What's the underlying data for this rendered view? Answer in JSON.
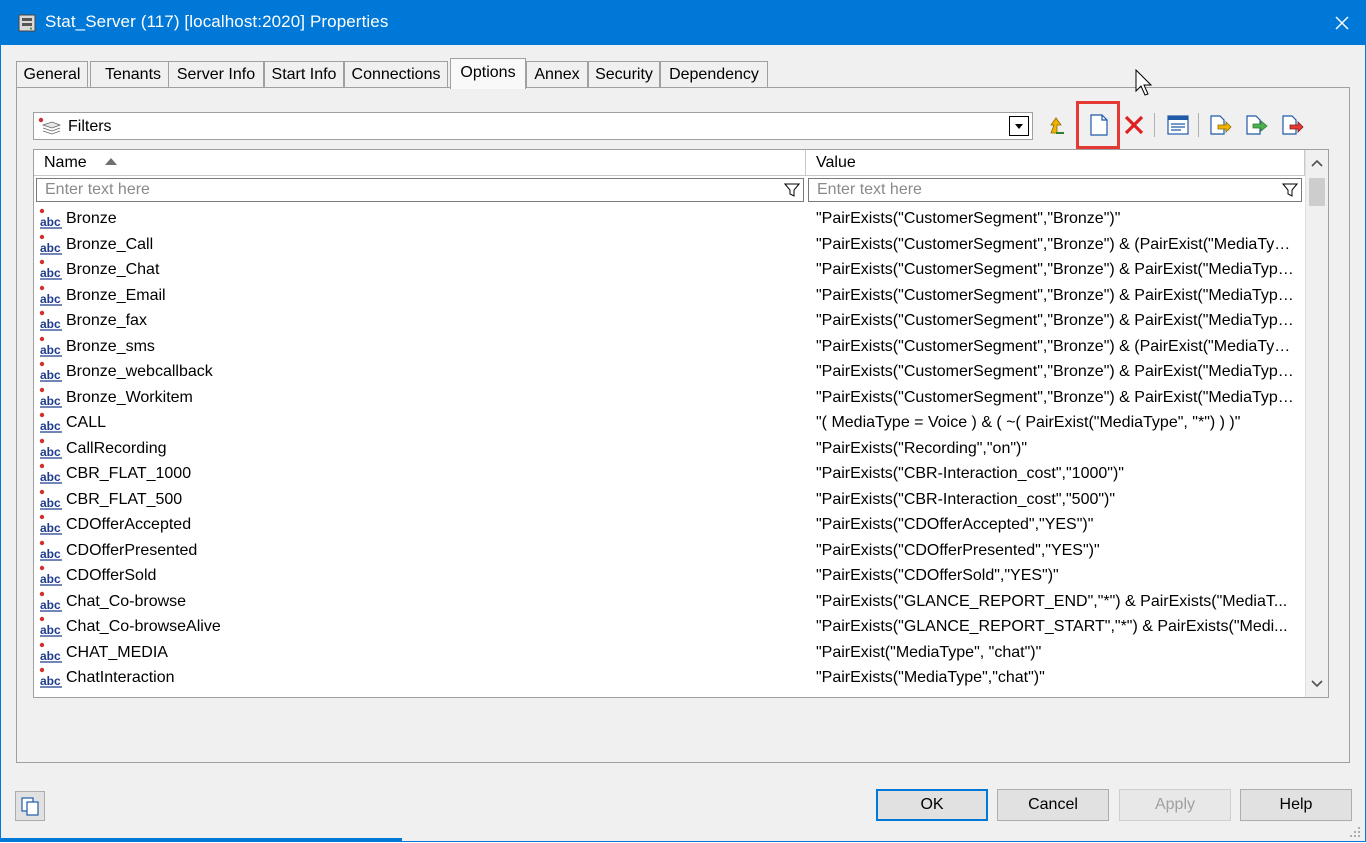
{
  "window": {
    "title": "Stat_Server (117) [localhost:2020] Properties",
    "accent": "#0078d7",
    "app_icon": "server-icon"
  },
  "tabs": [
    {
      "label": "General",
      "active": false
    },
    {
      "label": "Tenants",
      "active": false
    },
    {
      "label": "Server Info",
      "active": false
    },
    {
      "label": "Start Info",
      "active": false
    },
    {
      "label": "Connections",
      "active": false
    },
    {
      "label": "Options",
      "active": true
    },
    {
      "label": "Annex",
      "active": false
    },
    {
      "label": "Security",
      "active": false
    },
    {
      "label": "Dependency",
      "active": false
    }
  ],
  "section_combo": {
    "selected": "Filters",
    "icon": "section-stack-icon"
  },
  "toolbar": {
    "buttons": [
      {
        "name": "up-level-button",
        "icon": "up-arrow-icon"
      },
      {
        "name": "new-option-button",
        "icon": "new-document-icon",
        "highlighted": true
      },
      {
        "name": "delete-button",
        "icon": "red-x-icon"
      },
      {
        "name": "properties-button",
        "icon": "properties-icon"
      },
      {
        "name": "import-button",
        "icon": "import-icon"
      },
      {
        "name": "export-button",
        "icon": "export-icon"
      },
      {
        "name": "copy-section-button",
        "icon": "copy-section-icon"
      }
    ],
    "highlight_color": "#e53935"
  },
  "grid": {
    "columns": [
      {
        "label": "Name",
        "sort": "ascending"
      },
      {
        "label": "Value"
      }
    ],
    "filter_placeholder": "Enter text here",
    "rows": [
      {
        "name": "Bronze",
        "value": "\"PairExists(\"CustomerSegment\",\"Bronze\")\""
      },
      {
        "name": "Bronze_Call",
        "value": "\"PairExists(\"CustomerSegment\",\"Bronze\") & (PairExist(\"MediaTyp..."
      },
      {
        "name": "Bronze_Chat",
        "value": "\"PairExists(\"CustomerSegment\",\"Bronze\") & PairExist(\"MediaType..."
      },
      {
        "name": "Bronze_Email",
        "value": "\"PairExists(\"CustomerSegment\",\"Bronze\") & PairExist(\"MediaType..."
      },
      {
        "name": "Bronze_fax",
        "value": "\"PairExists(\"CustomerSegment\",\"Bronze\") & PairExist(\"MediaType..."
      },
      {
        "name": "Bronze_sms",
        "value": "\"PairExists(\"CustomerSegment\",\"Bronze\") & (PairExist(\"MediaTyp..."
      },
      {
        "name": "Bronze_webcallback",
        "value": "\"PairExists(\"CustomerSegment\",\"Bronze\") & PairExist(\"MediaType..."
      },
      {
        "name": "Bronze_Workitem",
        "value": "\"PairExists(\"CustomerSegment\",\"Bronze\") & PairExist(\"MediaType..."
      },
      {
        "name": "CALL",
        "value": "\"( MediaType = Voice ) & ( ~( PairExist(\"MediaType\", \"*\") ) )\""
      },
      {
        "name": "CallRecording",
        "value": "\"PairExists(\"Recording\",\"on\")\""
      },
      {
        "name": "CBR_FLAT_1000",
        "value": "\"PairExists(\"CBR-Interaction_cost\",\"1000\")\""
      },
      {
        "name": "CBR_FLAT_500",
        "value": "\"PairExists(\"CBR-Interaction_cost\",\"500\")\""
      },
      {
        "name": "CDOfferAccepted",
        "value": "\"PairExists(\"CDOfferAccepted\",\"YES\")\""
      },
      {
        "name": "CDOfferPresented",
        "value": "\"PairExists(\"CDOfferPresented\",\"YES\")\""
      },
      {
        "name": "CDOfferSold",
        "value": "\"PairExists(\"CDOfferSold\",\"YES\")\""
      },
      {
        "name": "Chat_Co-browse",
        "value": "\"PairExists(\"GLANCE_REPORT_END\",\"*\") & PairExists(\"MediaT..."
      },
      {
        "name": "Chat_Co-browseAlive",
        "value": "\"PairExists(\"GLANCE_REPORT_START\",\"*\") & PairExists(\"Medi..."
      },
      {
        "name": "CHAT_MEDIA",
        "value": "\"PairExist(\"MediaType\", \"chat\")\""
      },
      {
        "name": "ChatInteraction",
        "value": "\"PairExists(\"MediaType\",\"chat\")\""
      }
    ]
  },
  "footer": {
    "ok": "OK",
    "cancel": "Cancel",
    "apply": "Apply",
    "help": "Help",
    "apply_enabled": false
  }
}
